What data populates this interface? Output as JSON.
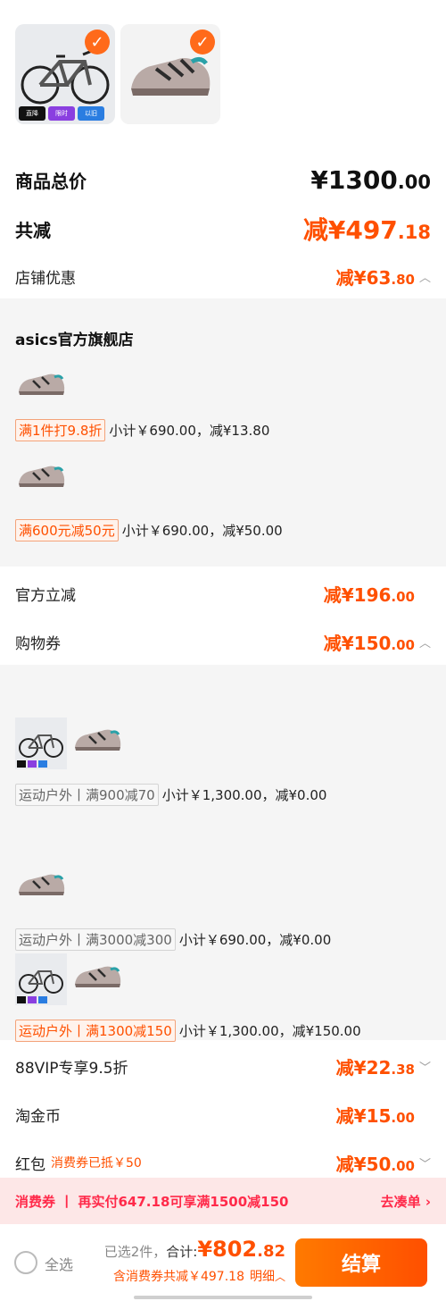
{
  "colors": {
    "accent": "#ff5000",
    "check": "#ff6a1a",
    "banner_bg": "#fde7e7"
  },
  "top_items": [
    {
      "name": "bicycle-thumb",
      "tags": [
        "直降",
        "限时",
        "以旧"
      ]
    },
    {
      "name": "shoe-thumb"
    }
  ],
  "summary": {
    "total_label": "商品总价",
    "total_main": "¥1300",
    "total_sub": ".00",
    "reduce_label": "共减",
    "reduce_main": "减¥497",
    "reduce_sub": ".18"
  },
  "store_discount": {
    "label": "店铺优惠",
    "main": "减¥63",
    "sub": ".80",
    "store_name": "asics官方旗舰店",
    "lines": [
      {
        "tag": "满1件打9.8折",
        "text": "小计￥690.00，减¥13.80"
      },
      {
        "tag": "满600元减50元",
        "text": "小计￥690.00，减¥50.00"
      }
    ]
  },
  "official": {
    "label": "官方立减",
    "main": "减¥196",
    "sub": ".00"
  },
  "coupon": {
    "label": "购物券",
    "main": "减¥150",
    "sub": ".00",
    "lines": [
      {
        "tag": "运动户外丨满900减70",
        "text": "小计￥1,300.00，减¥0.00"
      },
      {
        "tag": "运动户外丨满3000减300",
        "text": "小计￥690.00，减¥0.00"
      },
      {
        "tag": "运动户外丨满1300减150",
        "text": "小计￥1,300.00，减¥150.00"
      }
    ]
  },
  "vip": {
    "label": "88VIP专享9.5折",
    "main": "减¥22",
    "sub": ".38"
  },
  "gold": {
    "label": "淘金币",
    "main": "减¥15",
    "sub": ".00"
  },
  "redpack": {
    "label": "红包",
    "note": "消费券已抵￥50",
    "main": "减¥50",
    "sub": ".00"
  },
  "banner": {
    "prefix": "消费券",
    "sep": "丨",
    "text": "再实付647.18可享满1500减150",
    "link": "去凑单"
  },
  "footer": {
    "select_all": "全选",
    "selected": "已选2件，",
    "total_label": "合计:",
    "total_main": "¥802",
    "total_sub": ".82",
    "detail_text": "含消费券共减￥497.18",
    "detail_link": "明细",
    "checkout": "结算"
  }
}
